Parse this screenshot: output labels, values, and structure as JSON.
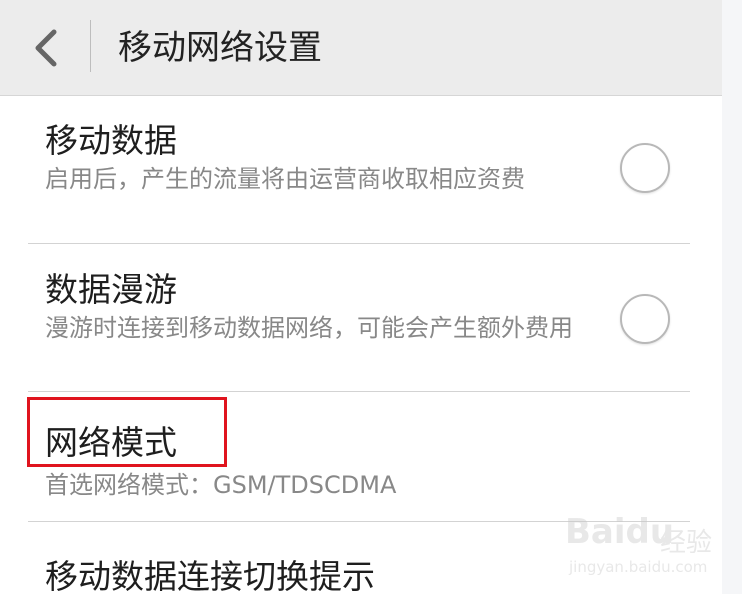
{
  "header": {
    "title": "移动网络设置",
    "back_icon": "chevron-left-icon"
  },
  "settings": [
    {
      "title": "移动数据",
      "description": "启用后，产生的流量将由运营商收取相应资费",
      "toggle_on": false
    },
    {
      "title": "数据漫游",
      "description": "漫游时连接到移动数据网络，可能会产生额外费用",
      "toggle_on": false
    },
    {
      "title": "网络模式",
      "summary": "首选网络模式：GSM/TDSCDMA"
    },
    {
      "title": "移动数据连接切换提示"
    }
  ],
  "annotation": {
    "highlight_color": "#e0141e"
  },
  "watermark": {
    "brand": "Baidu",
    "sub": "经验",
    "url": "jingyan.baidu.com"
  },
  "colors": {
    "header_bg": "#ececec",
    "title_text": "#1e1e1e",
    "secondary_text": "#888888",
    "divider": "#d3d3d3"
  }
}
